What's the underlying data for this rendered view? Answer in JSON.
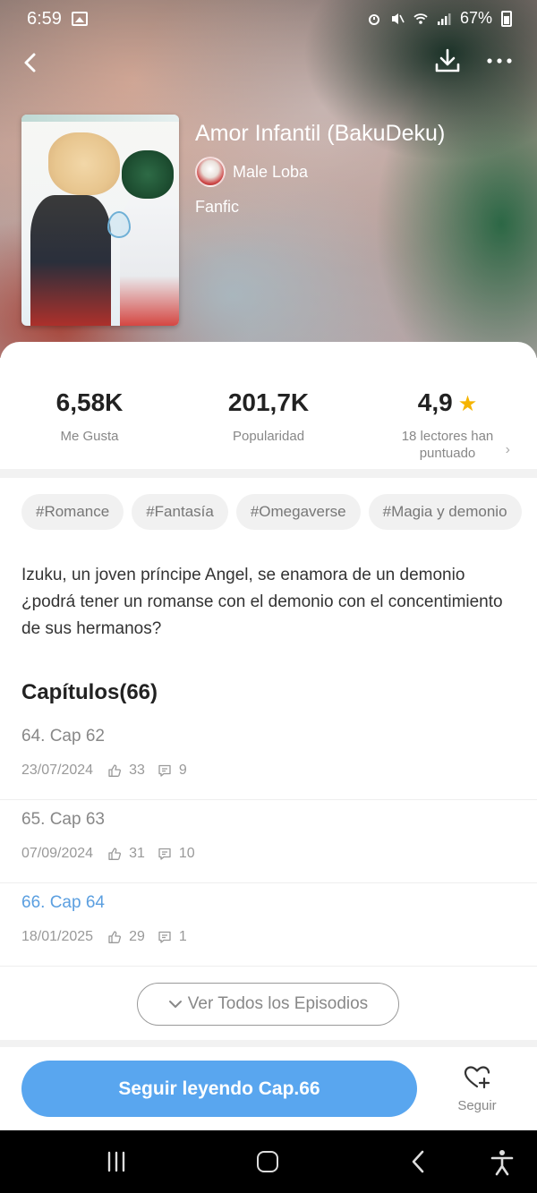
{
  "status_bar": {
    "time": "6:59",
    "battery": "67%"
  },
  "book": {
    "title": "Amor Infantil (BakuDeku)",
    "author": "Male Loba",
    "genre": "Fanfic"
  },
  "stats": [
    {
      "value": "6,58K",
      "label": "Me Gusta"
    },
    {
      "value": "201,7K",
      "label": "Popularidad"
    },
    {
      "value": "4,9",
      "label": "18 lectores han puntuado"
    }
  ],
  "tags": [
    "#Romance",
    "#Fantasía",
    "#Omegaverse",
    "#Magia y demonio"
  ],
  "description": "Izuku, un joven príncipe Angel, se enamora de un demonio ¿podrá tener un romanse con el demonio con el concentimiento de sus hermanos?",
  "chapters_title": "Capítulos(66)",
  "chapters": [
    {
      "name": "64. Cap 62",
      "date": "23/07/2024",
      "likes": "33",
      "comments": "9",
      "current": false
    },
    {
      "name": "65. Cap 63",
      "date": "07/09/2024",
      "likes": "31",
      "comments": "10",
      "current": false
    },
    {
      "name": "66. Cap 64",
      "date": "18/01/2025",
      "likes": "29",
      "comments": "1",
      "current": true
    }
  ],
  "view_all_label": "Ver Todos los Episodios",
  "continue_label": "Seguir leyendo Cap.66",
  "follow_label": "Seguir",
  "colors": {
    "accent": "#59a6ef",
    "current_chapter": "#5b9fe0",
    "star": "#f5b400"
  },
  "icons": [
    "back-icon",
    "download-icon",
    "more-icon",
    "star-icon",
    "like-icon",
    "comment-icon",
    "chevron-down-icon",
    "heart-plus-icon"
  ]
}
